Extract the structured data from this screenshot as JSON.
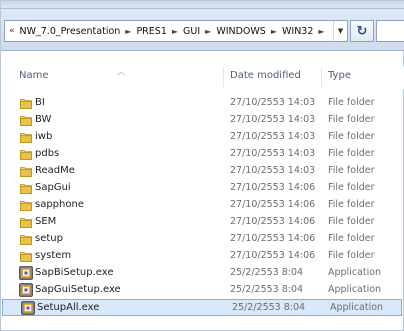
{
  "address_bar": {
    "lead": "«",
    "breadcrumbs": [
      "NW_7.0_Presentation",
      "PRES1",
      "GUI",
      "WINDOWS",
      "WIN32"
    ],
    "separator": "►",
    "dropdown": "▼",
    "refresh_symbol": "↻"
  },
  "columns": {
    "name": "Name",
    "date": "Date modified",
    "type": "Type"
  },
  "files": [
    {
      "name": "BI",
      "date": "27/10/2553 14:03",
      "type": "File folder",
      "icon": "folder-icon"
    },
    {
      "name": "BW",
      "date": "27/10/2553 14:03",
      "type": "File folder",
      "icon": "folder-icon"
    },
    {
      "name": "iwb",
      "date": "27/10/2553 14:03",
      "type": "File folder",
      "icon": "folder-icon"
    },
    {
      "name": "pdbs",
      "date": "27/10/2553 14:03",
      "type": "File folder",
      "icon": "folder-icon"
    },
    {
      "name": "ReadMe",
      "date": "27/10/2553 14:03",
      "type": "File folder",
      "icon": "folder-icon"
    },
    {
      "name": "SapGui",
      "date": "27/10/2553 14:06",
      "type": "File folder",
      "icon": "folder-icon"
    },
    {
      "name": "sapphone",
      "date": "27/10/2553 14:06",
      "type": "File folder",
      "icon": "folder-icon"
    },
    {
      "name": "SEM",
      "date": "27/10/2553 14:06",
      "type": "File folder",
      "icon": "folder-icon"
    },
    {
      "name": "setup",
      "date": "27/10/2553 14:06",
      "type": "File folder",
      "icon": "folder-icon"
    },
    {
      "name": "system",
      "date": "27/10/2553 14:06",
      "type": "File folder",
      "icon": "folder-icon"
    },
    {
      "name": "SapBiSetup.exe",
      "date": "25/2/2553 8:04",
      "type": "Application",
      "icon": "application-icon"
    },
    {
      "name": "SapGuiSetup.exe",
      "date": "25/2/2553 8:04",
      "type": "Application",
      "icon": "application-icon"
    },
    {
      "name": "SetupAll.exe",
      "date": "25/2/2553 8:04",
      "type": "Application",
      "icon": "application-icon",
      "selected": true
    }
  ],
  "colors": {
    "selection": "#d9e8fb",
    "folder": "#e8c24a",
    "header_text": "#4c607a"
  }
}
